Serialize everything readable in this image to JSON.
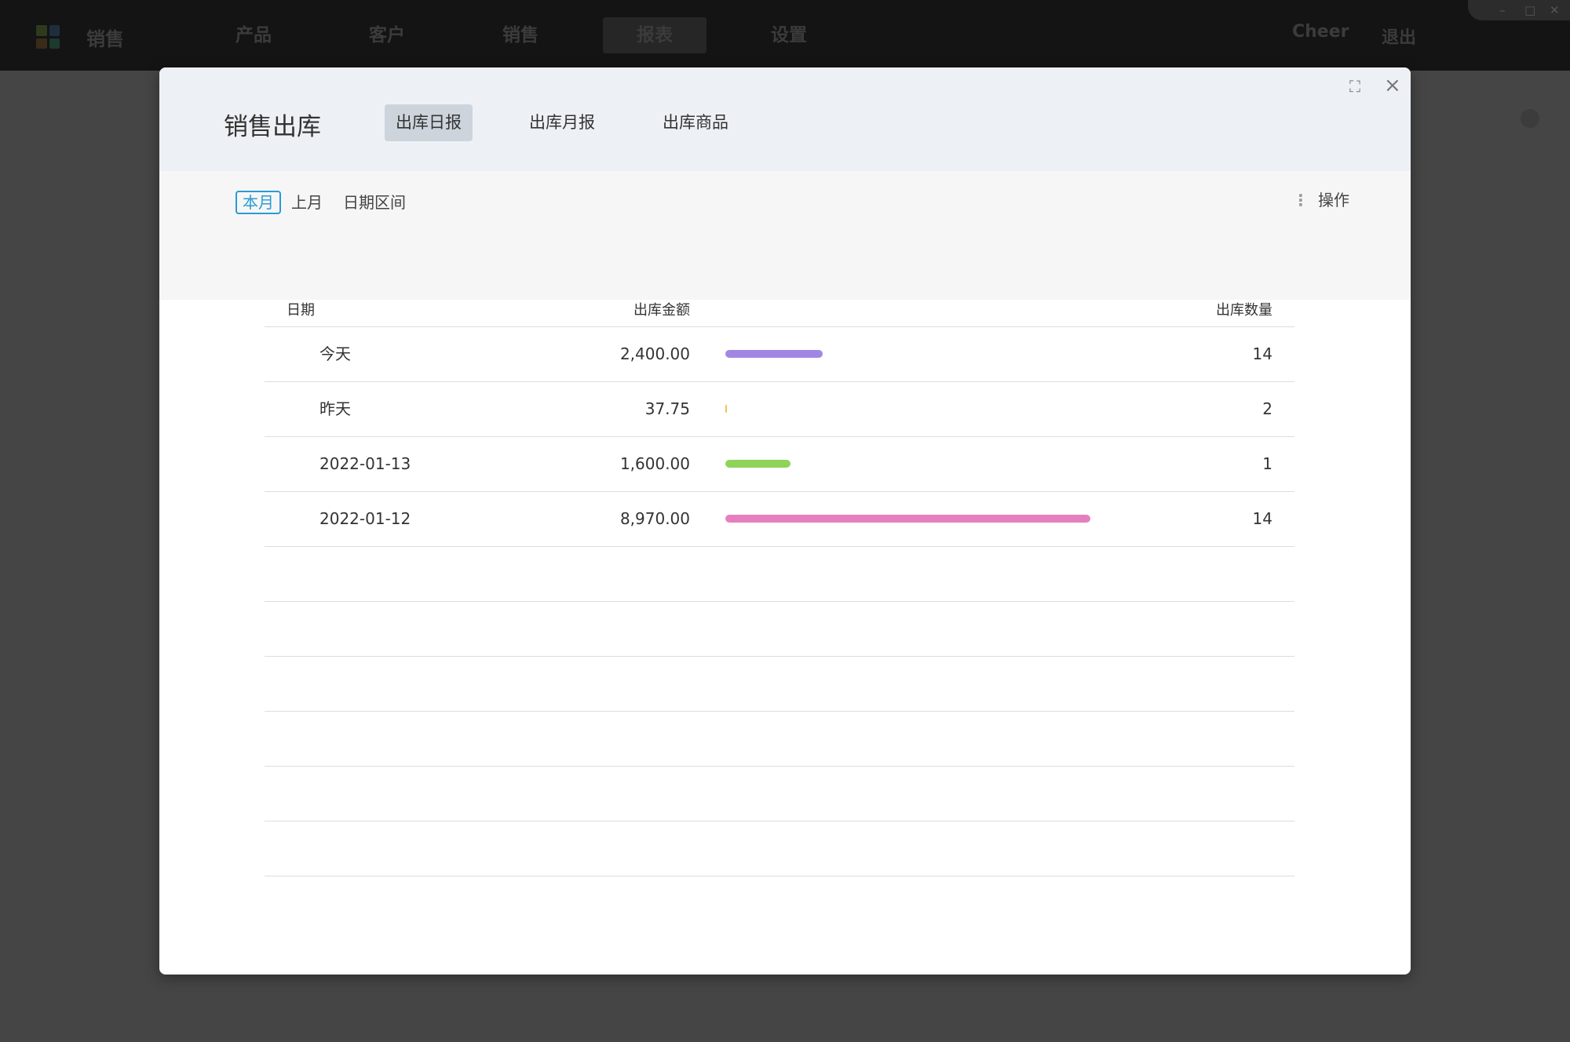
{
  "app": {
    "name": "销售",
    "logo_colors": [
      "#2e3a1c",
      "#1f2e3e",
      "#3b2a1a",
      "#1c3a2e"
    ],
    "nav": [
      {
        "label": "产品"
      },
      {
        "label": "客户"
      },
      {
        "label": "销售"
      },
      {
        "label": "报表",
        "active": true
      },
      {
        "label": "设置"
      }
    ],
    "user": "Cheer",
    "logout": "退出",
    "window_controls": [
      "–",
      "□",
      "✕"
    ]
  },
  "modal": {
    "title": "销售出库",
    "tabs": [
      {
        "label": "出库日报",
        "active": true
      },
      {
        "label": "出库月报"
      },
      {
        "label": "出库商品"
      }
    ],
    "icons": {
      "fullscreen": "⛶",
      "close": "×"
    },
    "filters": [
      {
        "label": "本月",
        "active": true
      },
      {
        "label": "上月"
      },
      {
        "label": "日期区间"
      }
    ],
    "ops_label": "操作",
    "ops_icon": "⋮"
  },
  "table": {
    "columns": {
      "date": "日期",
      "amount": "出库金额",
      "qty": "出库数量"
    },
    "rows": [
      {
        "date": "今天",
        "amount": "2,400.00",
        "qty": "14",
        "bar_value": 2400,
        "bar_color": "#a187e3"
      },
      {
        "date": "昨天",
        "amount": "37.75",
        "qty": "2",
        "bar_value": 37.75,
        "bar_color": "#f2c14e"
      },
      {
        "date": "2022-01-13",
        "amount": "1,600.00",
        "qty": "1",
        "bar_value": 1600,
        "bar_color": "#8fd35a"
      },
      {
        "date": "2022-01-12",
        "amount": "8,970.00",
        "qty": "14",
        "bar_value": 8970,
        "bar_color": "#e57fbd"
      }
    ],
    "empty_rows": 6
  }
}
